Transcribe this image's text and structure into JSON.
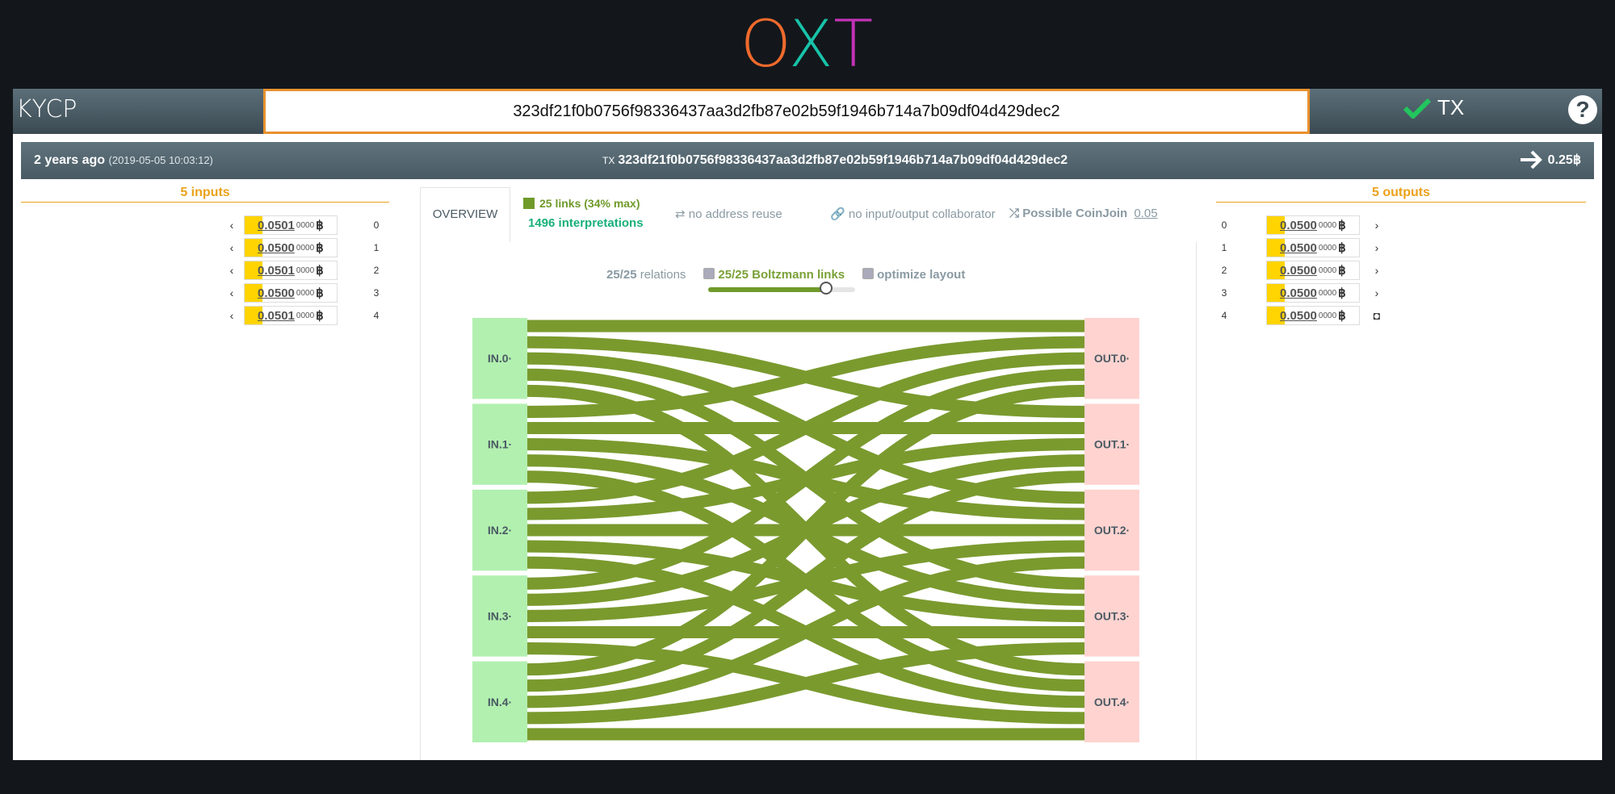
{
  "logo": {
    "o": "O",
    "x": "X",
    "t": "T"
  },
  "header": {
    "title": "KYCP",
    "search_value": "323df21f0b0756f98336437aa3d2fb87e02b59f1946b714a7b09df04d429dec2",
    "mode_label": "TX",
    "help": "?"
  },
  "tx": {
    "age": "2 years ago",
    "date": "(2019-05-05 10:03:12)",
    "tx_prefix": "TX",
    "txid": "323df21f0b0756f98336437aa3d2fb87e02b59f1946b714a7b09df04d429dec2",
    "total": "0.25฿"
  },
  "inputs": {
    "heading": "5 inputs",
    "items": [
      {
        "lead": "0.",
        "dec": "0501",
        "tail": "0000",
        "unit": "฿",
        "index": "0"
      },
      {
        "lead": "0.",
        "dec": "0500",
        "tail": "0000",
        "unit": "฿",
        "index": "1"
      },
      {
        "lead": "0.",
        "dec": "0501",
        "tail": "0000",
        "unit": "฿",
        "index": "2"
      },
      {
        "lead": "0.",
        "dec": "0500",
        "tail": "0000",
        "unit": "฿",
        "index": "3"
      },
      {
        "lead": "0.",
        "dec": "0501",
        "tail": "0000",
        "unit": "฿",
        "index": "4"
      }
    ]
  },
  "outputs": {
    "heading": "5 outputs",
    "items": [
      {
        "lead": "0.",
        "dec": "0500",
        "tail": "0000",
        "unit": "฿",
        "index": "0"
      },
      {
        "lead": "0.",
        "dec": "0500",
        "tail": "0000",
        "unit": "฿",
        "index": "1"
      },
      {
        "lead": "0.",
        "dec": "0500",
        "tail": "0000",
        "unit": "฿",
        "index": "2"
      },
      {
        "lead": "0.",
        "dec": "0500",
        "tail": "0000",
        "unit": "฿",
        "index": "3"
      },
      {
        "lead": "0.",
        "dec": "0500",
        "tail": "0000",
        "unit": "฿",
        "index": "4"
      }
    ]
  },
  "tabs": {
    "overview": "OVERVIEW",
    "links": "25 links (34% max)",
    "interpretations": "1496 interpretations",
    "no_address_reuse": "no address reuse",
    "no_collaborator": "no input/output collaborator",
    "coinjoin": "Possible CoinJoin",
    "coinjoin_score": "0.05"
  },
  "controls": {
    "relations_count": "25/25",
    "relations_label": "relations",
    "boltzmann": "25/25 Boltzmann links",
    "optimize": "optimize layout",
    "slider_level": 0.8
  },
  "sankey": {
    "in_labels": [
      "IN.0",
      "IN.1",
      "IN.2",
      "IN.3",
      "IN.4"
    ],
    "out_labels": [
      "OUT.0",
      "OUT.1",
      "OUT.2",
      "OUT.3",
      "OUT.4"
    ],
    "link_color": "#7a9a2e",
    "in_color": "#b2f0b0",
    "out_color": "#ffd3d0"
  },
  "colors": {
    "accent": "#e8912d",
    "gold": "#eba21b",
    "green": "#6f9a2a"
  }
}
